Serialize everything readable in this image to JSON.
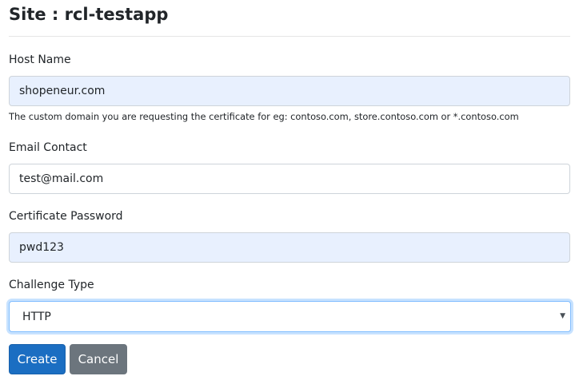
{
  "header": {
    "title": "Site : rcl-testapp"
  },
  "form": {
    "host_name": {
      "label": "Host Name",
      "value": "shopeneur.com",
      "help": "The custom domain you are requesting the certificate for eg: contoso.com, store.contoso.com or *.contoso.com"
    },
    "email_contact": {
      "label": "Email Contact",
      "value": "test@mail.com"
    },
    "certificate_password": {
      "label": "Certificate Password",
      "value": "pwd123"
    },
    "challenge_type": {
      "label": "Challenge Type",
      "selected": "HTTP"
    }
  },
  "actions": {
    "create_label": "Create",
    "cancel_label": "Cancel"
  },
  "icons": {
    "select_caret": "chevron-down-icon"
  },
  "colors": {
    "primary": "#1b6ec2",
    "secondary": "#6c757d",
    "autofill_bg": "#e8f0fe"
  }
}
